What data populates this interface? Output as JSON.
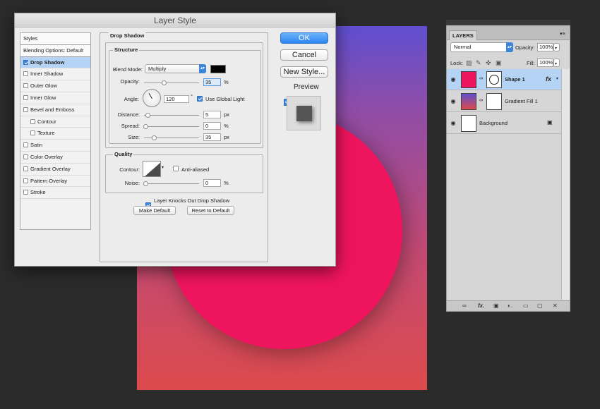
{
  "dialog": {
    "title": "Layer Style",
    "styles_list": [
      {
        "label": "Styles",
        "kind": "header"
      },
      {
        "label": "Blending Options: Default",
        "kind": "header"
      },
      {
        "label": "Drop Shadow",
        "checked": true,
        "active": true
      },
      {
        "label": "Inner Shadow",
        "checked": false
      },
      {
        "label": "Outer Glow",
        "checked": false
      },
      {
        "label": "Inner Glow",
        "checked": false
      },
      {
        "label": "Bevel and Emboss",
        "checked": false
      },
      {
        "label": "Contour",
        "checked": false,
        "sub": true
      },
      {
        "label": "Texture",
        "checked": false,
        "sub": true
      },
      {
        "label": "Satin",
        "checked": false
      },
      {
        "label": "Color Overlay",
        "checked": false
      },
      {
        "label": "Gradient Overlay",
        "checked": false
      },
      {
        "label": "Pattern Overlay",
        "checked": false
      },
      {
        "label": "Stroke",
        "checked": false
      }
    ],
    "drop_shadow": {
      "section_title": "Drop Shadow",
      "structure_title": "Structure",
      "blend_mode_label": "Blend Mode:",
      "blend_mode_value": "Multiply",
      "shadow_color": "#000000",
      "opacity_label": "Opacity:",
      "opacity_value": "35",
      "opacity_unit": "%",
      "angle_label": "Angle:",
      "angle_value": "120",
      "angle_unit": "°",
      "use_global_light_label": "Use Global Light",
      "use_global_light": true,
      "distance_label": "Distance:",
      "distance_value": "5",
      "distance_unit": "px",
      "spread_label": "Spread:",
      "spread_value": "0",
      "spread_unit": "%",
      "size_label": "Size:",
      "size_value": "35",
      "size_unit": "px",
      "quality_title": "Quality",
      "contour_label": "Contour:",
      "anti_aliased_label": "Anti-aliased",
      "anti_aliased": false,
      "noise_label": "Noise:",
      "noise_value": "0",
      "noise_unit": "%",
      "knockout_label": "Layer Knocks Out Drop Shadow",
      "knockout": true,
      "make_default_label": "Make Default",
      "reset_default_label": "Reset to Default"
    },
    "buttons": {
      "ok": "OK",
      "cancel": "Cancel",
      "new_style": "New Style...",
      "preview_label": "Preview",
      "preview_checked": true
    }
  },
  "layers_panel": {
    "tab_label": "LAYERS",
    "blend_mode": "Normal",
    "opacity_label": "Opacity:",
    "opacity_value": "100%",
    "lock_label": "Lock:",
    "fill_label": "Fill:",
    "fill_value": "100%",
    "layers": [
      {
        "name": "Shape 1",
        "selected": true,
        "fx": "fx"
      },
      {
        "name": "Gradient Fill 1",
        "selected": false
      },
      {
        "name": "Background",
        "selected": false
      }
    ]
  },
  "colors": {
    "accent": "#3b86d9",
    "circle": "#ef145e",
    "canvas_top": "#5f4fd0",
    "canvas_bottom": "#dc4a4c"
  }
}
